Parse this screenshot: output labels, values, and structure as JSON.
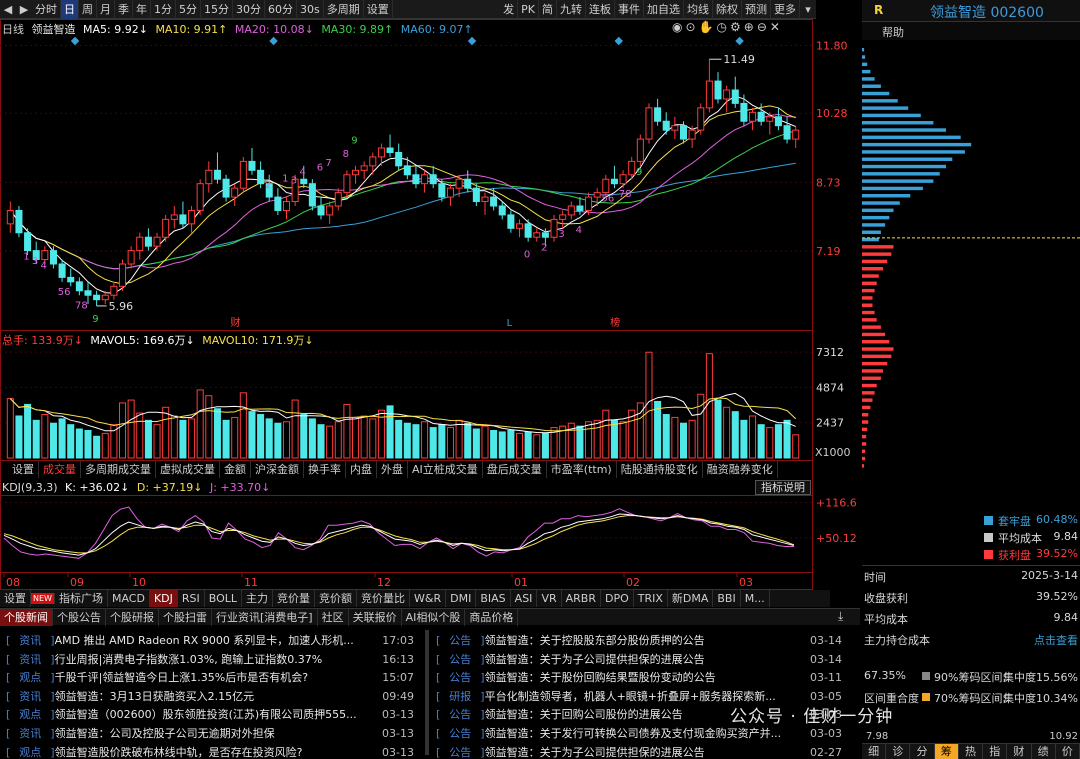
{
  "toolbar": {
    "left_items": [
      "分时",
      "日",
      "周",
      "月",
      "季",
      "年",
      "1分",
      "5分",
      "15分",
      "30分",
      "60分",
      "30s",
      "多周期",
      "设置"
    ],
    "active": "日",
    "right_items": [
      "发",
      "PK",
      "简",
      "九转",
      "连板",
      "事件",
      "加自选",
      "均线",
      "除权",
      "预测",
      "更多"
    ]
  },
  "header": {
    "r_label": "R",
    "stock": "领益智造 002600",
    "help": "帮助"
  },
  "kline": {
    "legend": {
      "period": "日线",
      "name": "领益智造",
      "ma5": "MA5: 9.92↓",
      "ma10": "MA10: 9.91↑",
      "ma20": "MA20: 10.08↓",
      "ma30": "MA30: 9.89↑",
      "ma60": "MA60: 9.07↑"
    },
    "y_ticks": [
      "11.80",
      "10.28",
      "8.73",
      "7.19"
    ],
    "high_label": "11.49",
    "low_label": "5.96",
    "markers": [
      "财",
      "L",
      "榜"
    ],
    "seq_labels": [
      "1",
      "3",
      "4",
      "56",
      "78",
      "9",
      "2",
      "1",
      "3",
      "4",
      "6",
      "7",
      "8",
      "9",
      "2",
      "3",
      "4",
      "56",
      "78",
      "9",
      "0"
    ],
    "ma_colors": {
      "ma5": "#ffffff",
      "ma10": "#f5e04a",
      "ma20": "#e060e0",
      "ma30": "#3cd04a",
      "ma60": "#3aa0d8"
    },
    "candles": [
      [
        7.8,
        8.3,
        7.6,
        8.1
      ],
      [
        8.1,
        8.2,
        7.5,
        7.6
      ],
      [
        7.6,
        7.7,
        7.1,
        7.2
      ],
      [
        7.2,
        7.4,
        6.9,
        7.0
      ],
      [
        7.0,
        7.3,
        6.9,
        7.2
      ],
      [
        7.2,
        7.3,
        6.8,
        6.9
      ],
      [
        6.9,
        7.0,
        6.5,
        6.6
      ],
      [
        6.6,
        6.8,
        6.4,
        6.5
      ],
      [
        6.5,
        6.6,
        6.2,
        6.3
      ],
      [
        6.3,
        6.5,
        6.0,
        6.2
      ],
      [
        6.2,
        6.3,
        5.96,
        6.1
      ],
      [
        6.1,
        6.3,
        6.0,
        6.2
      ],
      [
        6.2,
        6.5,
        6.1,
        6.4
      ],
      [
        6.4,
        7.0,
        6.3,
        6.9
      ],
      [
        6.9,
        7.3,
        6.8,
        7.2
      ],
      [
        7.2,
        7.6,
        7.0,
        7.5
      ],
      [
        7.5,
        7.7,
        7.2,
        7.3
      ],
      [
        7.3,
        7.6,
        7.2,
        7.5
      ],
      [
        7.5,
        8.0,
        7.4,
        7.9
      ],
      [
        7.9,
        8.2,
        7.7,
        8.0
      ],
      [
        8.0,
        8.3,
        7.7,
        7.8
      ],
      [
        7.8,
        8.2,
        7.6,
        8.1
      ],
      [
        8.1,
        8.8,
        8.0,
        8.7
      ],
      [
        8.7,
        9.2,
        8.5,
        9.0
      ],
      [
        9.0,
        9.4,
        8.7,
        8.8
      ],
      [
        8.8,
        8.9,
        8.3,
        8.4
      ],
      [
        8.4,
        8.7,
        8.2,
        8.6
      ],
      [
        8.6,
        9.3,
        8.5,
        9.2
      ],
      [
        9.2,
        9.5,
        8.9,
        9.0
      ],
      [
        9.0,
        9.2,
        8.6,
        8.7
      ],
      [
        8.7,
        8.9,
        8.3,
        8.4
      ],
      [
        8.4,
        8.6,
        8.0,
        8.1
      ],
      [
        8.1,
        8.4,
        7.9,
        8.3
      ],
      [
        8.3,
        8.9,
        8.2,
        8.8
      ],
      [
        8.8,
        9.1,
        8.6,
        8.7
      ],
      [
        8.7,
        8.8,
        8.1,
        8.2
      ],
      [
        8.2,
        8.4,
        7.9,
        8.0
      ],
      [
        8.0,
        8.3,
        7.8,
        8.2
      ],
      [
        8.2,
        8.6,
        8.1,
        8.5
      ],
      [
        8.5,
        9.0,
        8.4,
        8.9
      ],
      [
        8.9,
        9.1,
        8.7,
        9.0
      ],
      [
        9.0,
        9.2,
        8.8,
        9.1
      ],
      [
        9.1,
        9.4,
        8.9,
        9.3
      ],
      [
        9.3,
        9.6,
        9.1,
        9.5
      ],
      [
        9.5,
        9.8,
        9.3,
        9.4
      ],
      [
        9.4,
        9.6,
        9.0,
        9.1
      ],
      [
        9.1,
        9.3,
        8.8,
        8.9
      ],
      [
        8.9,
        9.1,
        8.6,
        8.7
      ],
      [
        8.7,
        9.0,
        8.5,
        8.9
      ],
      [
        8.9,
        9.1,
        8.6,
        8.7
      ],
      [
        8.7,
        8.8,
        8.3,
        8.4
      ],
      [
        8.4,
        8.7,
        8.2,
        8.6
      ],
      [
        8.6,
        8.9,
        8.4,
        8.8
      ],
      [
        8.8,
        9.0,
        8.5,
        8.6
      ],
      [
        8.6,
        8.7,
        8.2,
        8.3
      ],
      [
        8.3,
        8.5,
        8.0,
        8.4
      ],
      [
        8.4,
        8.6,
        8.1,
        8.2
      ],
      [
        8.2,
        8.3,
        7.9,
        8.0
      ],
      [
        8.0,
        8.1,
        7.6,
        7.7
      ],
      [
        7.7,
        7.9,
        7.5,
        7.8
      ],
      [
        7.8,
        7.9,
        7.4,
        7.5
      ],
      [
        7.5,
        7.7,
        7.4,
        7.6
      ],
      [
        7.6,
        7.7,
        7.3,
        7.5
      ],
      [
        7.5,
        8.0,
        7.4,
        7.9
      ],
      [
        7.9,
        8.1,
        7.7,
        8.0
      ],
      [
        8.0,
        8.3,
        7.9,
        8.2
      ],
      [
        8.2,
        8.4,
        8.0,
        8.1
      ],
      [
        8.1,
        8.5,
        8.0,
        8.4
      ],
      [
        8.4,
        8.6,
        8.2,
        8.5
      ],
      [
        8.5,
        8.9,
        8.4,
        8.8
      ],
      [
        8.8,
        9.1,
        8.6,
        8.7
      ],
      [
        8.7,
        9.0,
        8.6,
        8.9
      ],
      [
        8.9,
        9.3,
        8.8,
        9.2
      ],
      [
        9.2,
        9.8,
        9.1,
        9.7
      ],
      [
        9.7,
        10.5,
        9.6,
        10.4
      ],
      [
        10.4,
        10.6,
        10.0,
        10.1
      ],
      [
        10.1,
        10.3,
        9.8,
        9.9
      ],
      [
        9.9,
        10.2,
        9.7,
        10.0
      ],
      [
        10.0,
        10.1,
        9.6,
        9.7
      ],
      [
        9.7,
        10.0,
        9.5,
        9.9
      ],
      [
        9.9,
        10.5,
        9.8,
        10.4
      ],
      [
        10.4,
        11.49,
        10.3,
        11.0
      ],
      [
        11.0,
        11.2,
        10.5,
        10.6
      ],
      [
        10.6,
        10.9,
        10.3,
        10.8
      ],
      [
        10.8,
        11.1,
        10.4,
        10.5
      ],
      [
        10.5,
        10.7,
        10.0,
        10.1
      ],
      [
        10.1,
        10.4,
        9.9,
        10.3
      ],
      [
        10.3,
        10.5,
        10.0,
        10.1
      ],
      [
        10.1,
        10.3,
        9.8,
        10.2
      ],
      [
        10.2,
        10.4,
        9.9,
        10.0
      ],
      [
        10.0,
        10.2,
        9.6,
        9.7
      ],
      [
        9.7,
        10.0,
        9.5,
        9.9
      ]
    ]
  },
  "volume": {
    "legend": {
      "total": "总手: 133.9万↓",
      "mavol5": "MAVOL5: 169.6万↓",
      "mavol10": "MAVOL10: 171.9万↓"
    },
    "y_ticks": [
      "7312",
      "4874",
      "2437"
    ],
    "unit": "X1000",
    "values": [
      4100,
      2900,
      3700,
      2600,
      3000,
      2400,
      2700,
      2300,
      2000,
      1900,
      1500,
      1700,
      2300,
      3800,
      4000,
      3100,
      2600,
      2300,
      3500,
      2900,
      2600,
      2700,
      4700,
      4300,
      3400,
      2600,
      2800,
      4500,
      3200,
      3000,
      2700,
      2400,
      2500,
      4000,
      3000,
      2700,
      2300,
      2200,
      2500,
      3700,
      2800,
      2900,
      2700,
      3300,
      3600,
      2600,
      2400,
      2300,
      2500,
      2100,
      2300,
      2100,
      2600,
      2400,
      2000,
      2200,
      1900,
      1800,
      1900,
      1700,
      1800,
      1600,
      1700,
      2100,
      2200,
      2400,
      2200,
      2500,
      2600,
      3300,
      2600,
      2500,
      3300,
      3800,
      7300,
      3900,
      3000,
      2800,
      2400,
      2600,
      4400,
      7200,
      4000,
      3500,
      3200,
      2600,
      2900,
      2300,
      2100,
      2300,
      2600,
      1600
    ]
  },
  "vol_tabs": [
    "设置",
    "成交量",
    "多周期成交量",
    "虚拟成交量",
    "金额",
    "沪深金额",
    "换手率",
    "内盘",
    "外盘",
    "AI立桩成交量",
    "盘后成交量",
    "市盈率(ttm)",
    "陆股通持股变化",
    "融资融券变化"
  ],
  "kdj": {
    "legend": {
      "name": "KDJ(9,3,3)",
      "k": "K: +36.02↓",
      "d": "D: +37.19↓",
      "j": "J: +33.70↓"
    },
    "explain": "指标说明",
    "y_ticks": [
      "+116.6",
      "+50.12"
    ],
    "k": [
      55,
      48,
      40,
      35,
      30,
      28,
      25,
      22,
      20,
      18,
      22,
      30,
      45,
      60,
      72,
      80,
      75,
      70,
      68,
      72,
      70,
      66,
      74,
      80,
      76,
      62,
      58,
      68,
      64,
      56,
      50,
      44,
      42,
      52,
      48,
      40,
      36,
      38,
      44,
      58,
      62,
      66,
      70,
      74,
      72,
      64,
      56,
      48,
      46,
      44,
      38,
      42,
      46,
      42,
      36,
      40,
      38,
      32,
      26,
      28,
      26,
      28,
      30,
      40,
      48,
      58,
      62,
      70,
      74,
      80,
      82,
      84,
      86,
      90,
      95,
      94,
      92,
      90,
      88,
      86,
      88,
      92,
      88,
      86,
      84,
      78,
      76,
      72,
      70,
      66,
      56,
      52,
      48,
      44,
      40,
      36
    ],
    "d": [
      58,
      54,
      48,
      42,
      36,
      32,
      28,
      26,
      24,
      22,
      22,
      26,
      34,
      44,
      56,
      66,
      70,
      70,
      68,
      70,
      70,
      68,
      70,
      74,
      74,
      68,
      62,
      64,
      64,
      60,
      54,
      50,
      46,
      48,
      48,
      44,
      40,
      39,
      42,
      50,
      56,
      60,
      66,
      70,
      70,
      66,
      60,
      54,
      50,
      47,
      42,
      42,
      44,
      42,
      39,
      40,
      39,
      36,
      31,
      30,
      28,
      28,
      29,
      34,
      40,
      48,
      54,
      62,
      68,
      74,
      78,
      80,
      82,
      86,
      90,
      92,
      92,
      90,
      89,
      88,
      88,
      90,
      88,
      87,
      85,
      81,
      78,
      75,
      72,
      69,
      62,
      57,
      52,
      48,
      43,
      37
    ],
    "j": [
      50,
      36,
      24,
      20,
      18,
      20,
      18,
      16,
      14,
      12,
      22,
      40,
      66,
      92,
      104,
      108,
      86,
      70,
      68,
      76,
      70,
      62,
      82,
      92,
      80,
      50,
      48,
      78,
      64,
      48,
      42,
      32,
      36,
      60,
      48,
      32,
      28,
      36,
      48,
      74,
      74,
      76,
      78,
      82,
      76,
      60,
      48,
      36,
      38,
      38,
      30,
      42,
      50,
      42,
      30,
      40,
      36,
      24,
      16,
      24,
      22,
      28,
      32,
      52,
      64,
      78,
      78,
      86,
      86,
      92,
      90,
      92,
      94,
      98,
      105,
      98,
      92,
      90,
      86,
      82,
      88,
      96,
      88,
      84,
      82,
      72,
      72,
      66,
      66,
      60,
      44,
      42,
      40,
      36,
      34,
      34
    ],
    "colors": {
      "k": "#ffffff",
      "d": "#f5e04a",
      "j": "#e060e0"
    }
  },
  "date_axis": [
    "08",
    "09",
    "10",
    "11",
    "12",
    "01",
    "02",
    "03"
  ],
  "indicator_tabs": [
    "设置",
    "NEW",
    "指标广场",
    "MACD",
    "KDJ",
    "RSI",
    "BOLL",
    "主力",
    "竞价量",
    "竞价额",
    "竞价量比",
    "W&R",
    "DMI",
    "BIAS",
    "ASI",
    "VR",
    "ARBR",
    "DPO",
    "TRIX",
    "新DMA",
    "BBI",
    "M..."
  ],
  "news_tabs": [
    "个股新闻",
    "个股公告",
    "个股研报",
    "个股扫雷",
    "行业资讯[消费电子]",
    "社区",
    "关联报价",
    "AI相似个股",
    "商品价格"
  ],
  "news_left": [
    {
      "cat": "资讯",
      "title": "AMD 推出 AMD Radeon RX 9000 系列显卡，加速人形机...",
      "date": "17:03"
    },
    {
      "cat": "资讯",
      "title": "行业周报|消费电子指数涨1.03%, 跑输上证指数0.37%",
      "date": "16:13"
    },
    {
      "cat": "观点",
      "title": "千股千评|领益智造今日上涨1.35%后市是否有机会?",
      "date": "15:07"
    },
    {
      "cat": "资讯",
      "title": "领益智造：3月13日获融资买入2.15亿元",
      "date": "09:49"
    },
    {
      "cat": "观点",
      "title": "领益智造（002600）股东领胜投资(江苏)有限公司质押555...",
      "date": "03-13"
    },
    {
      "cat": "资讯",
      "title": "领益智造：公司及控股子公司无逾期对外担保",
      "date": "03-13"
    },
    {
      "cat": "观点",
      "title": "领益智造股价跌破布林线中轨，是否存在投资风险?",
      "date": "03-13"
    }
  ],
  "news_right": [
    {
      "cat": "公告",
      "title": "领益智造：关于控股股东部分股份质押的公告",
      "date": "03-14"
    },
    {
      "cat": "公告",
      "title": "领益智造：关于为子公司提供担保的进展公告",
      "date": "03-14"
    },
    {
      "cat": "公告",
      "title": "领益智造：关于股份回购结果暨股份变动的公告",
      "date": "03-11"
    },
    {
      "cat": "研报",
      "title": "平台化制造领导者，机器人+眼镜+折叠屏+服务器探索新...",
      "date": "03-05"
    },
    {
      "cat": "公告",
      "title": "领益智造：关于回购公司股份的进展公告",
      "date": "03-03"
    },
    {
      "cat": "公告",
      "title": "领益智造：关于发行可转换公司债券及支付现金购买资产并...",
      "date": "03-03"
    },
    {
      "cat": "公告",
      "title": "领益智造：关于为子公司提供担保的进展公告",
      "date": "02-27"
    }
  ],
  "chips": {
    "bars": [
      2,
      3,
      5,
      8,
      12,
      18,
      26,
      34,
      44,
      56,
      68,
      80,
      94,
      104,
      98,
      86,
      80,
      74,
      68,
      58,
      46,
      36,
      30,
      26,
      22,
      18,
      16,
      30,
      28,
      24,
      20,
      16,
      14,
      12,
      10,
      10,
      12,
      14,
      18,
      22,
      26,
      30,
      28,
      24,
      20,
      18,
      14,
      12,
      10,
      8,
      6,
      6,
      5,
      4,
      4,
      3,
      3,
      2
    ],
    "split_index": 27,
    "legend": [
      {
        "label": "套牢盘",
        "value": "60.48%",
        "color": "#3aa0d8"
      },
      {
        "label": "平均成本",
        "value": "9.84",
        "color": "#c8c8c8"
      },
      {
        "label": "获利盘",
        "value": "39.52%",
        "color": "#ff3b3b"
      }
    ],
    "price_axis": [
      "7.98",
      "10.92"
    ],
    "rows": [
      {
        "label": "时间",
        "value": "2025-3-14"
      },
      {
        "label": "收盘获利",
        "value": "39.52%"
      },
      {
        "label": "平均成本",
        "value": "9.84"
      },
      {
        "label": "主力持仓成本",
        "value": "点击查看"
      }
    ],
    "conc": [
      {
        "left": "67.35%",
        "mid": "90%筹码区间:",
        "right": "集中度15.56%"
      },
      {
        "left": "区间重合度",
        "mid": "70%筹码区间:",
        "right": "集中度10.34%"
      }
    ],
    "bottom_tabs": [
      "细",
      "诊",
      "分",
      "筹",
      "热",
      "指",
      "财",
      "绩",
      "价"
    ],
    "active_tab": "筹"
  },
  "watermark": "公众号 · 佳财一分钟"
}
